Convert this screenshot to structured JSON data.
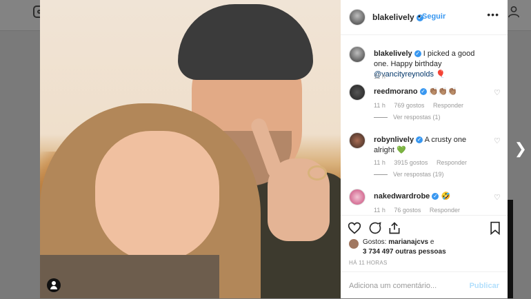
{
  "post": {
    "author": "blakelively",
    "follow_label": "Seguir",
    "more_label": "•••",
    "caption_text": "I picked a good one. Happy birthday",
    "caption_mention": "@vancityreynolds",
    "caption_emoji": "🎈",
    "caption_time": "11 h"
  },
  "comments": [
    {
      "user": "reedmorano",
      "text": "👏🏽👏🏽👏🏽",
      "time": "11 h",
      "likes": "769 gostos",
      "reply": "Responder",
      "view_replies": "Ver respostas (1)"
    },
    {
      "user": "robynlively",
      "text": "A crusty one alright 💚",
      "time": "11 h",
      "likes": "3915 gostos",
      "reply": "Responder",
      "view_replies": "Ver respostas (19)"
    },
    {
      "user": "nakedwardrobe",
      "text": "🤣",
      "time": "11 h",
      "likes": "76 gostos",
      "reply": "Responder"
    }
  ],
  "likes": {
    "prefix": "Gostos:",
    "user": "marianajcvs",
    "connector": "e",
    "count_text": "3 734 497 outras pessoas"
  },
  "timestamp": "HÁ 11 HORAS",
  "add_comment": {
    "placeholder": "Adiciona um comentário...",
    "publish_label": "Publicar"
  },
  "colors": {
    "accent": "#3897f0",
    "publish_disabled": "#b2dffc",
    "mention": "#003569"
  }
}
